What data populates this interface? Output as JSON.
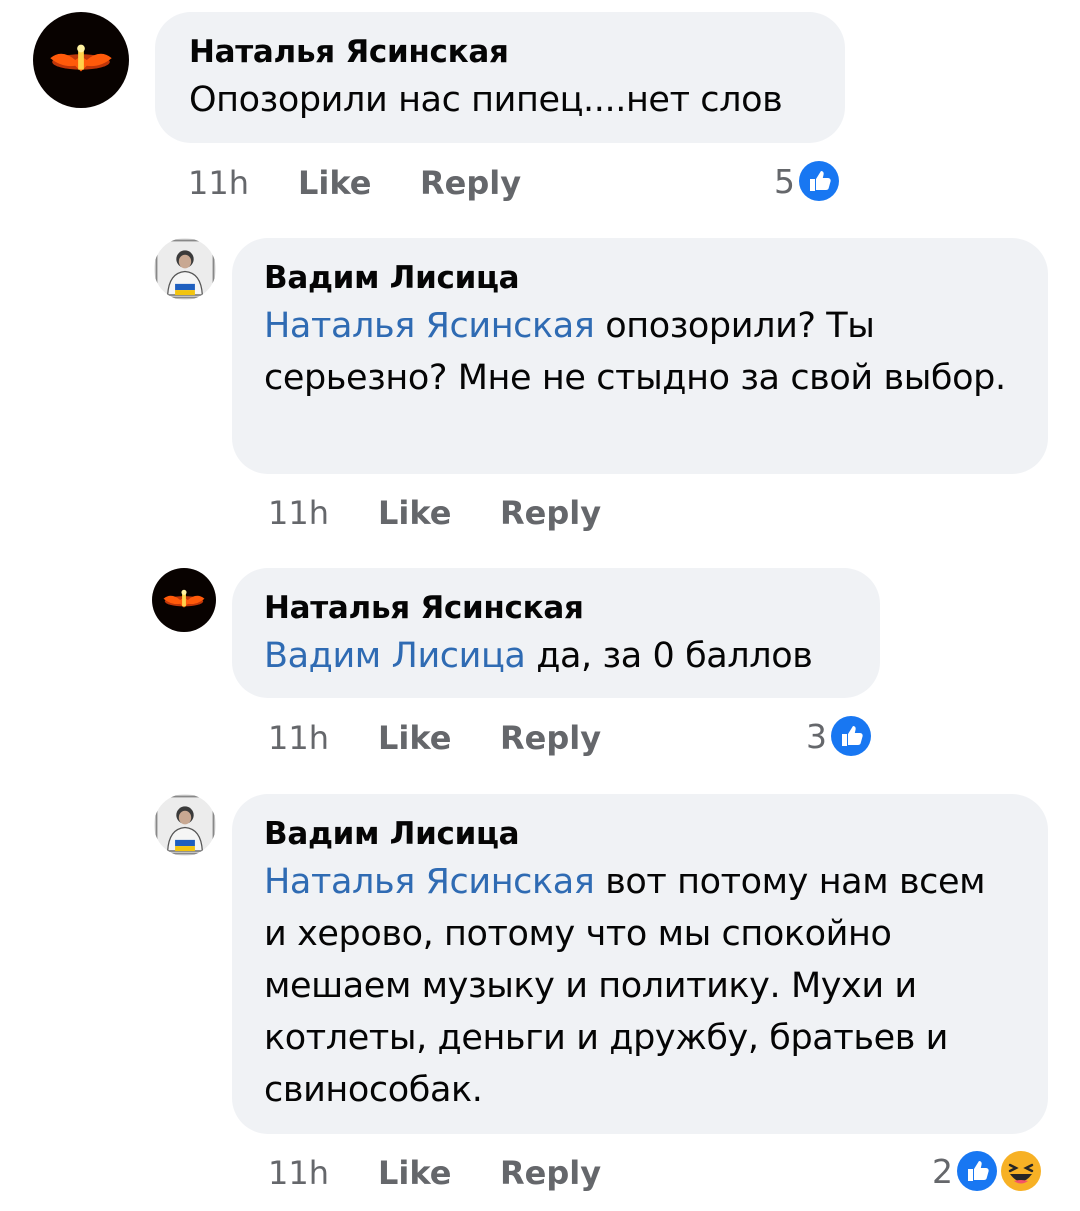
{
  "comments": [
    {
      "author": "Наталья Ясинская",
      "mention": "",
      "text": "Опозорили нас пипец....нет слов",
      "time": "11h",
      "like": "Like",
      "reply": "Reply",
      "reaction_count": "5",
      "reactions": [
        "like-icon"
      ]
    },
    {
      "author": "Вадим Лисица",
      "mention": "Наталья Ясинская",
      "text": " опозорили? Ты серьезно? Мне не стыдно за свой выбор.",
      "time": "11h",
      "like": "Like",
      "reply": "Reply",
      "reaction_count": "",
      "reactions": []
    },
    {
      "author": "Наталья Ясинская",
      "mention": "Вадим Лисица",
      "text": " да, за 0 баллов",
      "time": "11h",
      "like": "Like",
      "reply": "Reply",
      "reaction_count": "3",
      "reactions": [
        "like-icon"
      ]
    },
    {
      "author": "Вадим Лисица",
      "mention": "Наталья Ясинская",
      "text": " вот потому нам всем и херово, потому что мы спокойно мешаем музыку и политику. Мухи и котлеты, деньги и дружбу, братьев и свинособак.",
      "time": "11h",
      "like": "Like",
      "reply": "Reply",
      "reaction_count": "2",
      "reactions": [
        "like-icon",
        "haha-icon"
      ]
    }
  ],
  "colors": {
    "bubble": "#f0f2f5",
    "mention": "#2f6bb3",
    "meta": "#65676b",
    "like_blue": "#1877f2",
    "haha_yellow": "#f7b125"
  }
}
